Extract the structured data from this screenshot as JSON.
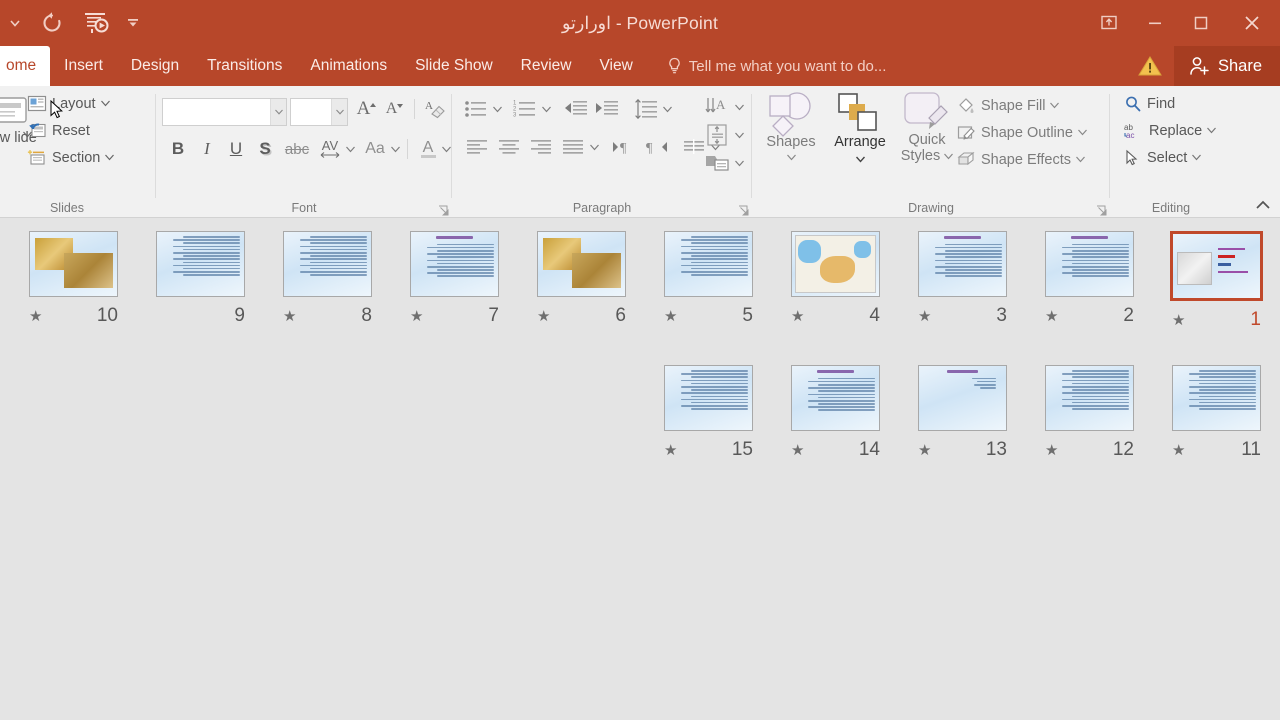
{
  "window": {
    "title": "اورارتو - PowerPoint",
    "qat": [
      {
        "name": "autosave-toggle-icon",
        "glyph": "▾"
      },
      {
        "name": "undo-icon",
        "glyph": "↺"
      },
      {
        "name": "start-slideshow-icon",
        "glyph": "▣"
      },
      {
        "name": "customize-qat-icon",
        "glyph": "▾"
      }
    ],
    "controls": {
      "ribbon_display_options": "⬆",
      "minimize": "—",
      "restore": "❐",
      "close": "✕"
    }
  },
  "tabs": [
    {
      "label": "ome",
      "active": true,
      "name": "tab-home"
    },
    {
      "label": "Insert",
      "active": false,
      "name": "tab-insert"
    },
    {
      "label": "Design",
      "active": false,
      "name": "tab-design"
    },
    {
      "label": "Transitions",
      "active": false,
      "name": "tab-transitions"
    },
    {
      "label": "Animations",
      "active": false,
      "name": "tab-animations"
    },
    {
      "label": "Slide Show",
      "active": false,
      "name": "tab-slide-show"
    },
    {
      "label": "Review",
      "active": false,
      "name": "tab-review"
    },
    {
      "label": "View",
      "active": false,
      "name": "tab-view"
    }
  ],
  "tellme": {
    "placeholder": "Tell me what you want to do..."
  },
  "share": {
    "label": "Share"
  },
  "ribbon": {
    "groups": {
      "slides": {
        "label": "Slides",
        "new_slide": "New lide",
        "layout": "Layout",
        "reset": "Reset",
        "section": "Section"
      },
      "font": {
        "label": "Font",
        "font_name_value": "",
        "font_size_value": "",
        "grow_font": "A",
        "shrink_font": "A",
        "clear_formatting": "A",
        "bold": "B",
        "italic": "I",
        "underline": "U",
        "shadow": "S",
        "strikethrough": "abc",
        "character_spacing": "AV",
        "change_case": "Aa",
        "font_color": "A"
      },
      "paragraph": {
        "label": "Paragraph"
      },
      "drawing": {
        "label": "Drawing",
        "shapes": "Shapes",
        "arrange": "Arrange",
        "quick_styles_line1": "Quick",
        "quick_styles_line2": "Styles",
        "shape_fill": "Shape Fill",
        "shape_outline": "Shape Outline",
        "shape_effects": "Shape Effects"
      },
      "editing": {
        "label": "Editing",
        "find": "Find",
        "replace": "Replace",
        "select": "Select"
      }
    }
  },
  "colors": {
    "brand": "#b7472a",
    "share_bg": "#a63d21",
    "ribbon_bg": "#f1f1f1",
    "canvas_bg": "#e4e4e4",
    "selection": "#c0492b"
  },
  "sorter": {
    "rows": [
      {
        "slides": [
          {
            "number": "1",
            "starred": true,
            "selected": true,
            "kind": "title-image"
          },
          {
            "number": "2",
            "starred": true,
            "selected": false,
            "kind": "text-heading"
          },
          {
            "number": "3",
            "starred": true,
            "selected": false,
            "kind": "text-heading"
          },
          {
            "number": "4",
            "starred": true,
            "selected": false,
            "kind": "map"
          },
          {
            "number": "5",
            "starred": true,
            "selected": false,
            "kind": "text"
          },
          {
            "number": "6",
            "starred": true,
            "selected": false,
            "kind": "two-images"
          },
          {
            "number": "7",
            "starred": true,
            "selected": false,
            "kind": "text-heading"
          },
          {
            "number": "8",
            "starred": true,
            "selected": false,
            "kind": "text"
          },
          {
            "number": "9",
            "starred": false,
            "selected": false,
            "kind": "text"
          },
          {
            "number": "10",
            "starred": true,
            "selected": false,
            "kind": "two-images"
          }
        ]
      },
      {
        "slides": [
          {
            "number": "11",
            "starred": true,
            "selected": false,
            "kind": "text"
          },
          {
            "number": "12",
            "starred": true,
            "selected": false,
            "kind": "text"
          },
          {
            "number": "13",
            "starred": true,
            "selected": false,
            "kind": "sparse-text"
          },
          {
            "number": "14",
            "starred": true,
            "selected": false,
            "kind": "text-heading"
          },
          {
            "number": "15",
            "starred": true,
            "selected": false,
            "kind": "text"
          }
        ]
      }
    ]
  }
}
